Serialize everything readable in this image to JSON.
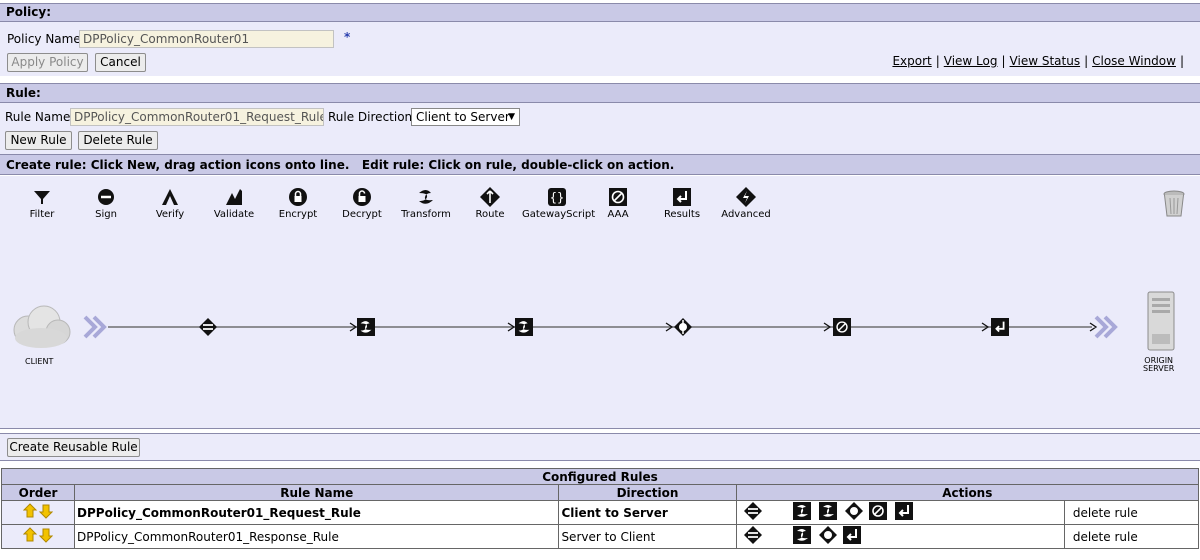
{
  "policy": {
    "section_title": "Policy:",
    "name_label": "Policy Name:",
    "name_value": "DPPolicy_CommonRouter01",
    "required_mark": "*",
    "apply_button": "Apply Policy",
    "cancel_button": "Cancel",
    "links": [
      "Export",
      "View Log",
      "View Status",
      "Close Window"
    ]
  },
  "rule": {
    "section_title": "Rule:",
    "name_label": "Rule Name:",
    "name_value": "DPPolicy_CommonRouter01_Request_Rule",
    "direction_label": "Rule Direction:",
    "direction_value": "Client to Server",
    "new_button": "New Rule",
    "delete_button": "Delete Rule"
  },
  "instructions": "Create rule: Click New, drag action icons onto line.   Edit rule: Click on rule, double-click on action.",
  "palette": [
    {
      "label": "Filter",
      "icon": "filter-icon"
    },
    {
      "label": "Sign",
      "icon": "sign-icon"
    },
    {
      "label": "Verify",
      "icon": "verify-icon"
    },
    {
      "label": "Validate",
      "icon": "validate-icon"
    },
    {
      "label": "Encrypt",
      "icon": "encrypt-icon"
    },
    {
      "label": "Decrypt",
      "icon": "decrypt-icon"
    },
    {
      "label": "Transform",
      "icon": "transform-icon"
    },
    {
      "label": "Route",
      "icon": "route-icon"
    },
    {
      "label": "GatewayScript",
      "icon": "gatewayscript-icon"
    },
    {
      "label": "AAA",
      "icon": "aaa-icon"
    },
    {
      "label": "Results",
      "icon": "results-icon"
    },
    {
      "label": "Advanced",
      "icon": "advanced-icon"
    }
  ],
  "pipeline": {
    "client_label": "CLIENT",
    "server_label_line1": "ORIGIN",
    "server_label_line2": "SERVER",
    "actions": [
      "match-icon",
      "transform-icon",
      "transform-icon",
      "route-icon",
      "aaa-icon",
      "results-icon"
    ]
  },
  "reusable_button": "Create Reusable Rule",
  "configured": {
    "title": "Configured Rules",
    "headers": {
      "order": "Order",
      "name": "Rule Name",
      "direction": "Direction",
      "actions": "Actions"
    },
    "rows": [
      {
        "name": "DPPolicy_CommonRouter01_Request_Rule",
        "direction": "Client to Server",
        "delete": "delete rule",
        "selected": true,
        "actions": [
          "match-icon",
          "transform-icon",
          "transform-icon",
          "route-icon",
          "aaa-icon",
          "results-icon"
        ]
      },
      {
        "name": "DPPolicy_CommonRouter01_Response_Rule",
        "direction": "Server to Client",
        "delete": "delete rule",
        "selected": false,
        "actions": [
          "match-icon",
          "transform-icon",
          "route-icon",
          "results-icon"
        ]
      }
    ]
  },
  "colors": {
    "header_bar": "#c9c9e6",
    "panel_bg": "#ebebfa",
    "input_bg": "#f6f2df",
    "arrow_yellow": "#f2c200",
    "chevron": "#a8a8d8"
  }
}
